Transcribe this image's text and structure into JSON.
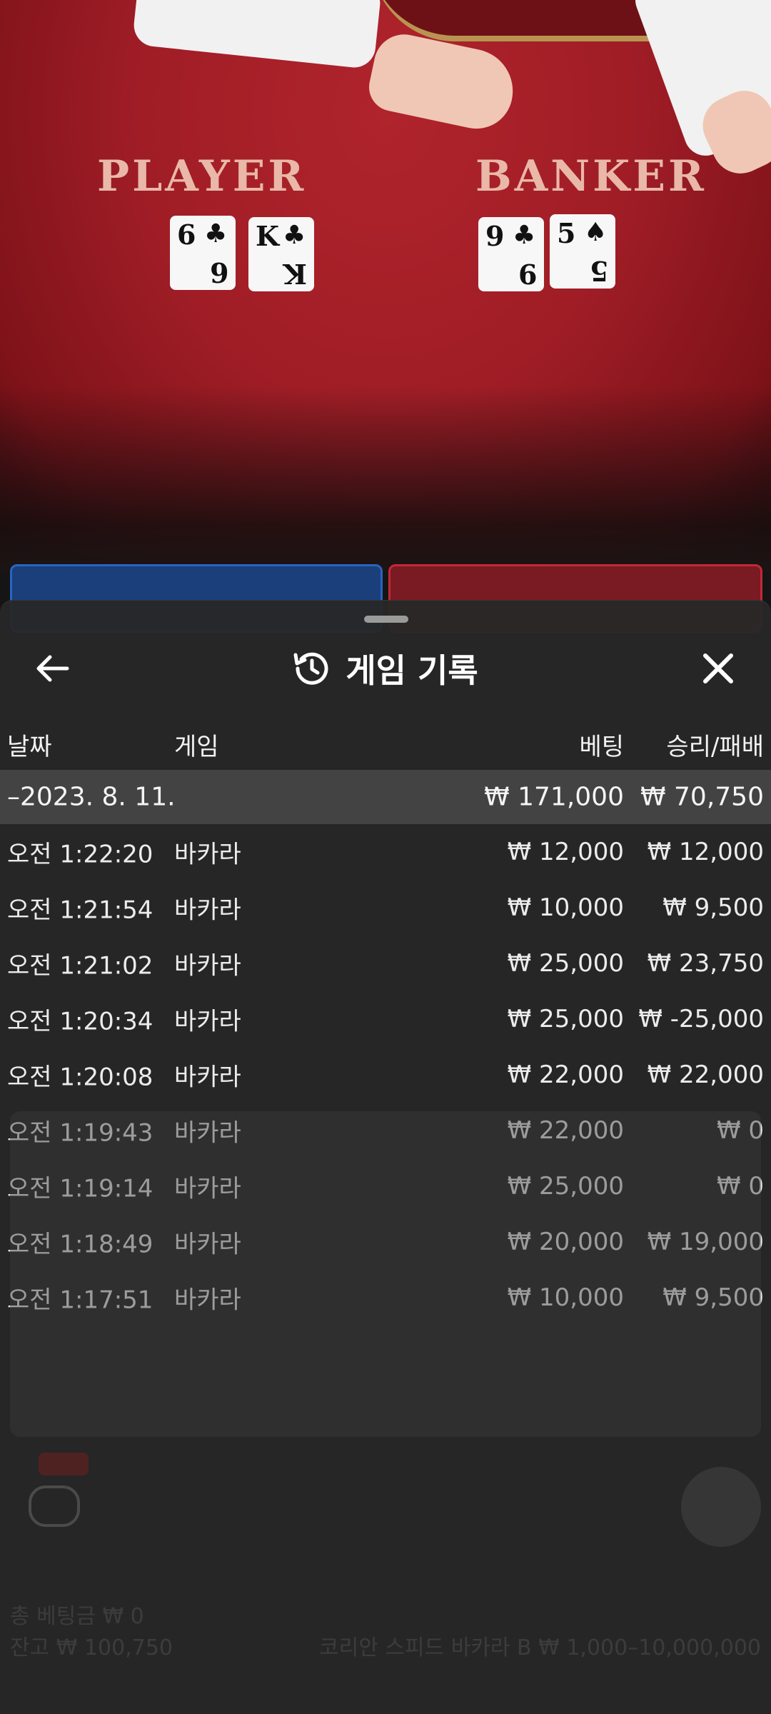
{
  "video": {
    "player_label": "PLAYER",
    "banker_label": "BANKER",
    "player_cards": [
      {
        "rank": "6",
        "suit": "♣"
      },
      {
        "rank": "K",
        "suit": "♣"
      }
    ],
    "banker_cards": [
      {
        "rank": "9",
        "suit": "♣"
      },
      {
        "rank": "5",
        "suit": "♠"
      }
    ]
  },
  "history": {
    "title": "게임 기록",
    "icons": {
      "back": "arrow-left-icon",
      "history": "history-clock-icon",
      "close": "close-icon"
    },
    "columns": {
      "date": "날짜",
      "game": "게임",
      "bet": "베팅",
      "result": "승리/패배"
    },
    "day": {
      "date": "–2023. 8. 11.",
      "bet": "₩ 171,000",
      "result": "₩ 70,750"
    },
    "rows": [
      {
        "time": "오전 1:22:20",
        "game": "바카라",
        "bet": "₩ 12,000",
        "result": "₩ 12,000"
      },
      {
        "time": "오전 1:21:54",
        "game": "바카라",
        "bet": "₩ 10,000",
        "result": "₩ 9,500"
      },
      {
        "time": "오전 1:21:02",
        "game": "바카라",
        "bet": "₩ 25,000",
        "result": "₩ 23,750"
      },
      {
        "time": "오전 1:20:34",
        "game": "바카라",
        "bet": "₩ 25,000",
        "result": "₩ -25,000"
      },
      {
        "time": "오전 1:20:08",
        "game": "바카라",
        "bet": "₩ 22,000",
        "result": "₩ 22,000"
      },
      {
        "time": "오전 1:19:43",
        "game": "바카라",
        "bet": "₩ 22,000",
        "result": "₩ 0"
      },
      {
        "time": "오전 1:19:14",
        "game": "바카라",
        "bet": "₩ 25,000",
        "result": "₩ 0"
      },
      {
        "time": "오전 1:18:49",
        "game": "바카라",
        "bet": "₩ 20,000",
        "result": "₩ 19,000"
      },
      {
        "time": "오전 1:17:51",
        "game": "바카라",
        "bet": "₩ 10,000",
        "result": "₩ 9,500"
      }
    ]
  },
  "footer": {
    "total_bet": "총 베팅금 ₩ 0",
    "balance": "잔고 ₩ 100,750",
    "table_info": "코리안 스피드 바카라 B ₩ 1,000–10,000,000"
  }
}
